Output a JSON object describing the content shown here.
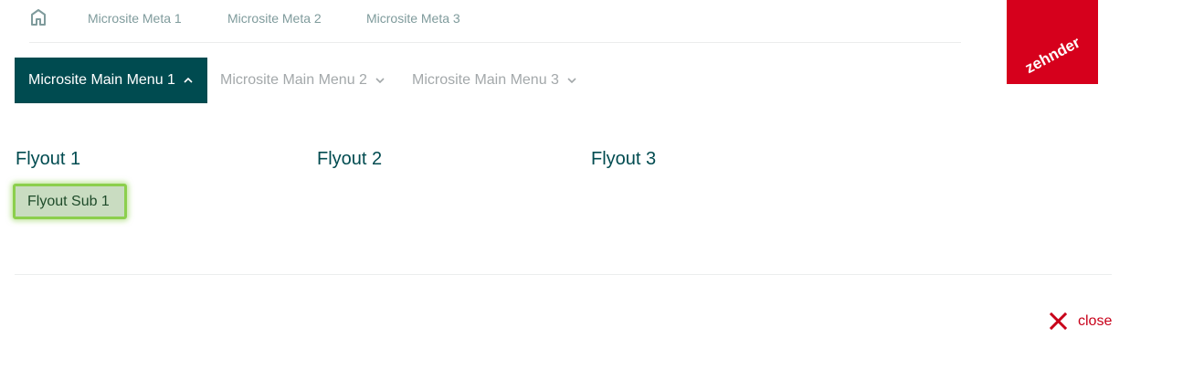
{
  "meta_nav": {
    "home_icon": "home-icon",
    "links": [
      "Microsite Meta 1",
      "Microsite Meta 2",
      "Microsite Meta 3"
    ]
  },
  "logo": {
    "text": "zehnder",
    "color": "#d6001c"
  },
  "main_nav": {
    "items": [
      {
        "label": "Microsite Main Menu 1",
        "active": true,
        "icon": "chevron-up-icon"
      },
      {
        "label": "Microsite Main Menu 2",
        "active": false,
        "icon": "chevron-down-icon"
      },
      {
        "label": "Microsite Main Menu 3",
        "active": false,
        "icon": "chevron-down-icon"
      }
    ]
  },
  "flyout": {
    "headings": [
      "Flyout 1",
      "Flyout 2",
      "Flyout 3"
    ],
    "sub_items": [
      "Flyout Sub 1"
    ]
  },
  "close": {
    "label": "close",
    "icon": "close-icon"
  },
  "colors": {
    "brand_dark": "#004b50",
    "brand_red": "#d6001c",
    "highlight_green": "#8ccf4d",
    "inactive_text": "#a3a8aa",
    "meta_text": "#7f9b9c"
  }
}
